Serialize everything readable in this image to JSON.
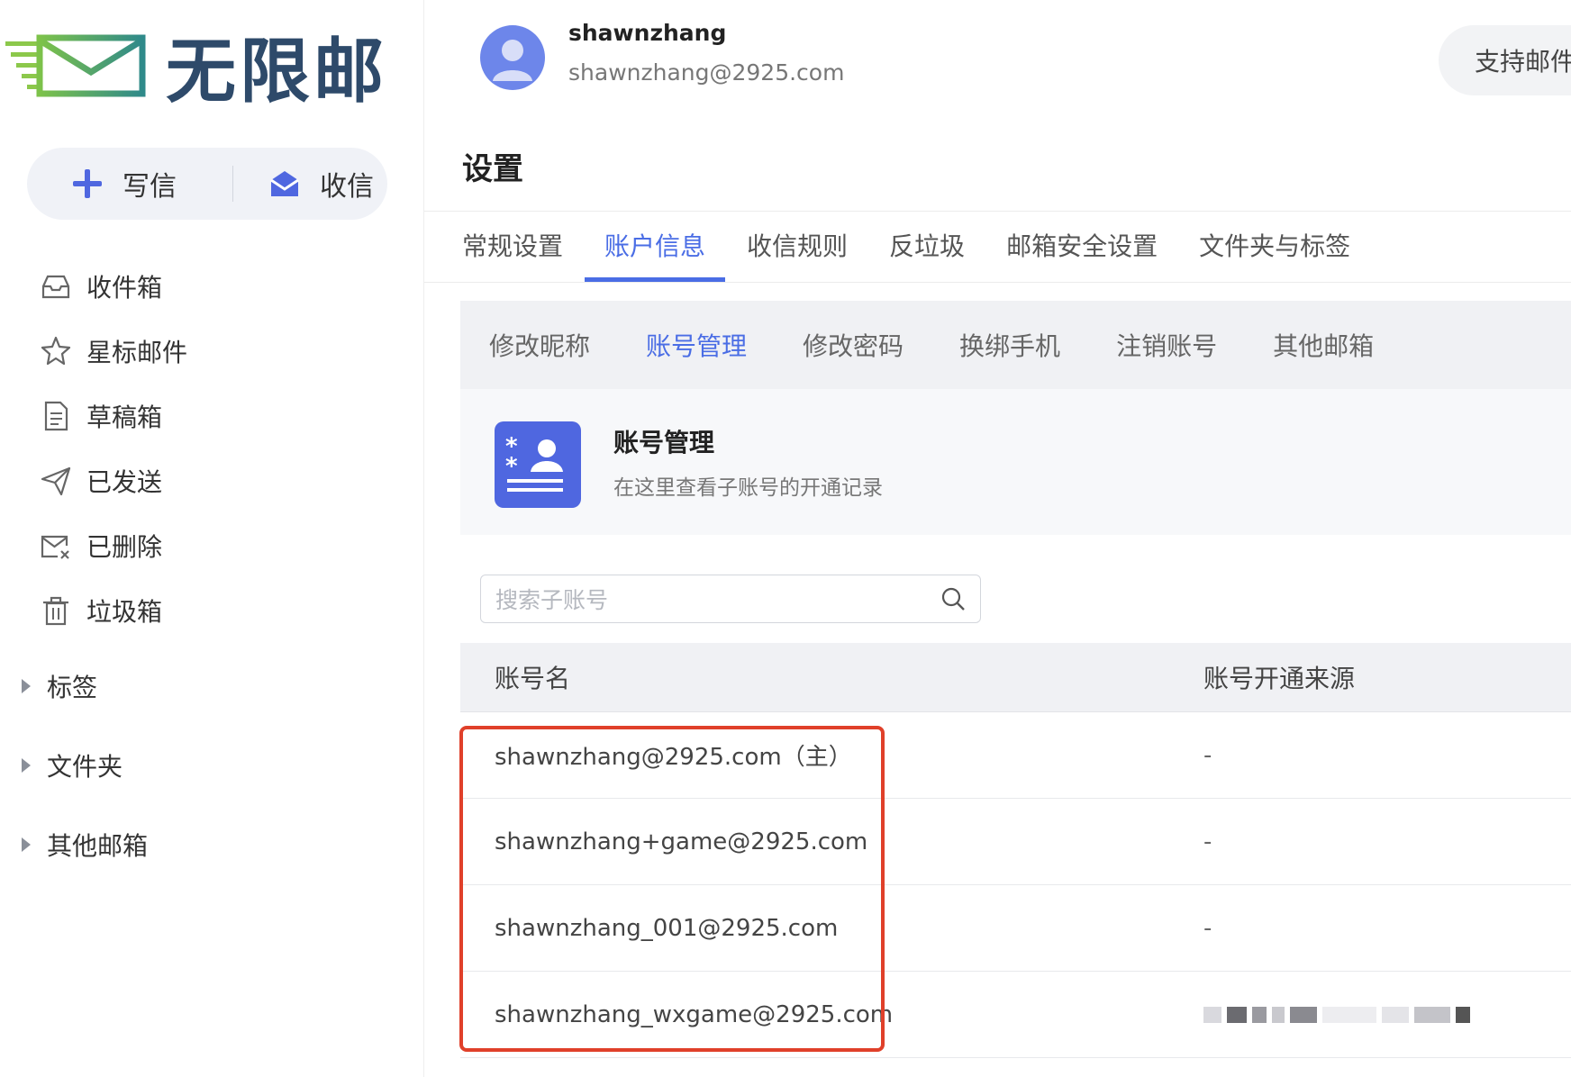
{
  "app": {
    "logo_text": "无限邮",
    "brand_color": "#2e4a6a",
    "accent_color": "#4a6de5"
  },
  "sidebar": {
    "compose_label": "写信",
    "receive_label": "收信",
    "nav_items": [
      {
        "label": "收件箱",
        "icon": "inbox-icon"
      },
      {
        "label": "星标邮件",
        "icon": "star-icon"
      },
      {
        "label": "草稿箱",
        "icon": "draft-icon"
      },
      {
        "label": "已发送",
        "icon": "send-icon"
      },
      {
        "label": "已删除",
        "icon": "deleted-mail-icon"
      },
      {
        "label": "垃圾箱",
        "icon": "trash-icon"
      }
    ],
    "tree_items": [
      {
        "label": "标签"
      },
      {
        "label": "文件夹"
      },
      {
        "label": "其他邮箱"
      }
    ]
  },
  "user": {
    "name": "shawnzhang",
    "email": "shawnzhang@2925.com"
  },
  "header": {
    "support_button": "支持邮件"
  },
  "settings": {
    "title": "设置",
    "tabs": [
      {
        "label": "常规设置",
        "active": false
      },
      {
        "label": "账户信息",
        "active": true
      },
      {
        "label": "收信规则",
        "active": false
      },
      {
        "label": "反垃圾",
        "active": false
      },
      {
        "label": "邮箱安全设置",
        "active": false
      },
      {
        "label": "文件夹与标签",
        "active": false
      }
    ],
    "subtabs": [
      {
        "label": "修改昵称",
        "active": false
      },
      {
        "label": "账号管理",
        "active": true
      },
      {
        "label": "修改密码",
        "active": false
      },
      {
        "label": "换绑手机",
        "active": false
      },
      {
        "label": "注销账号",
        "active": false
      },
      {
        "label": "其他邮箱",
        "active": false
      }
    ]
  },
  "account_mgmt": {
    "title": "账号管理",
    "description": "在这里查看子账号的开通记录",
    "search_placeholder": "搜索子账号",
    "columns": {
      "name": "账号名",
      "source": "账号开通来源"
    },
    "rows": [
      {
        "name": "shawnzhang@2925.com（主）",
        "source": "-"
      },
      {
        "name": "shawnzhang+game@2925.com",
        "source": "-"
      },
      {
        "name": "shawnzhang_001@2925.com",
        "source": "-"
      },
      {
        "name": "shawnzhang_wxgame@2925.com",
        "source": "",
        "source_blurred": true
      }
    ],
    "highlight_color": "#e0402a"
  }
}
